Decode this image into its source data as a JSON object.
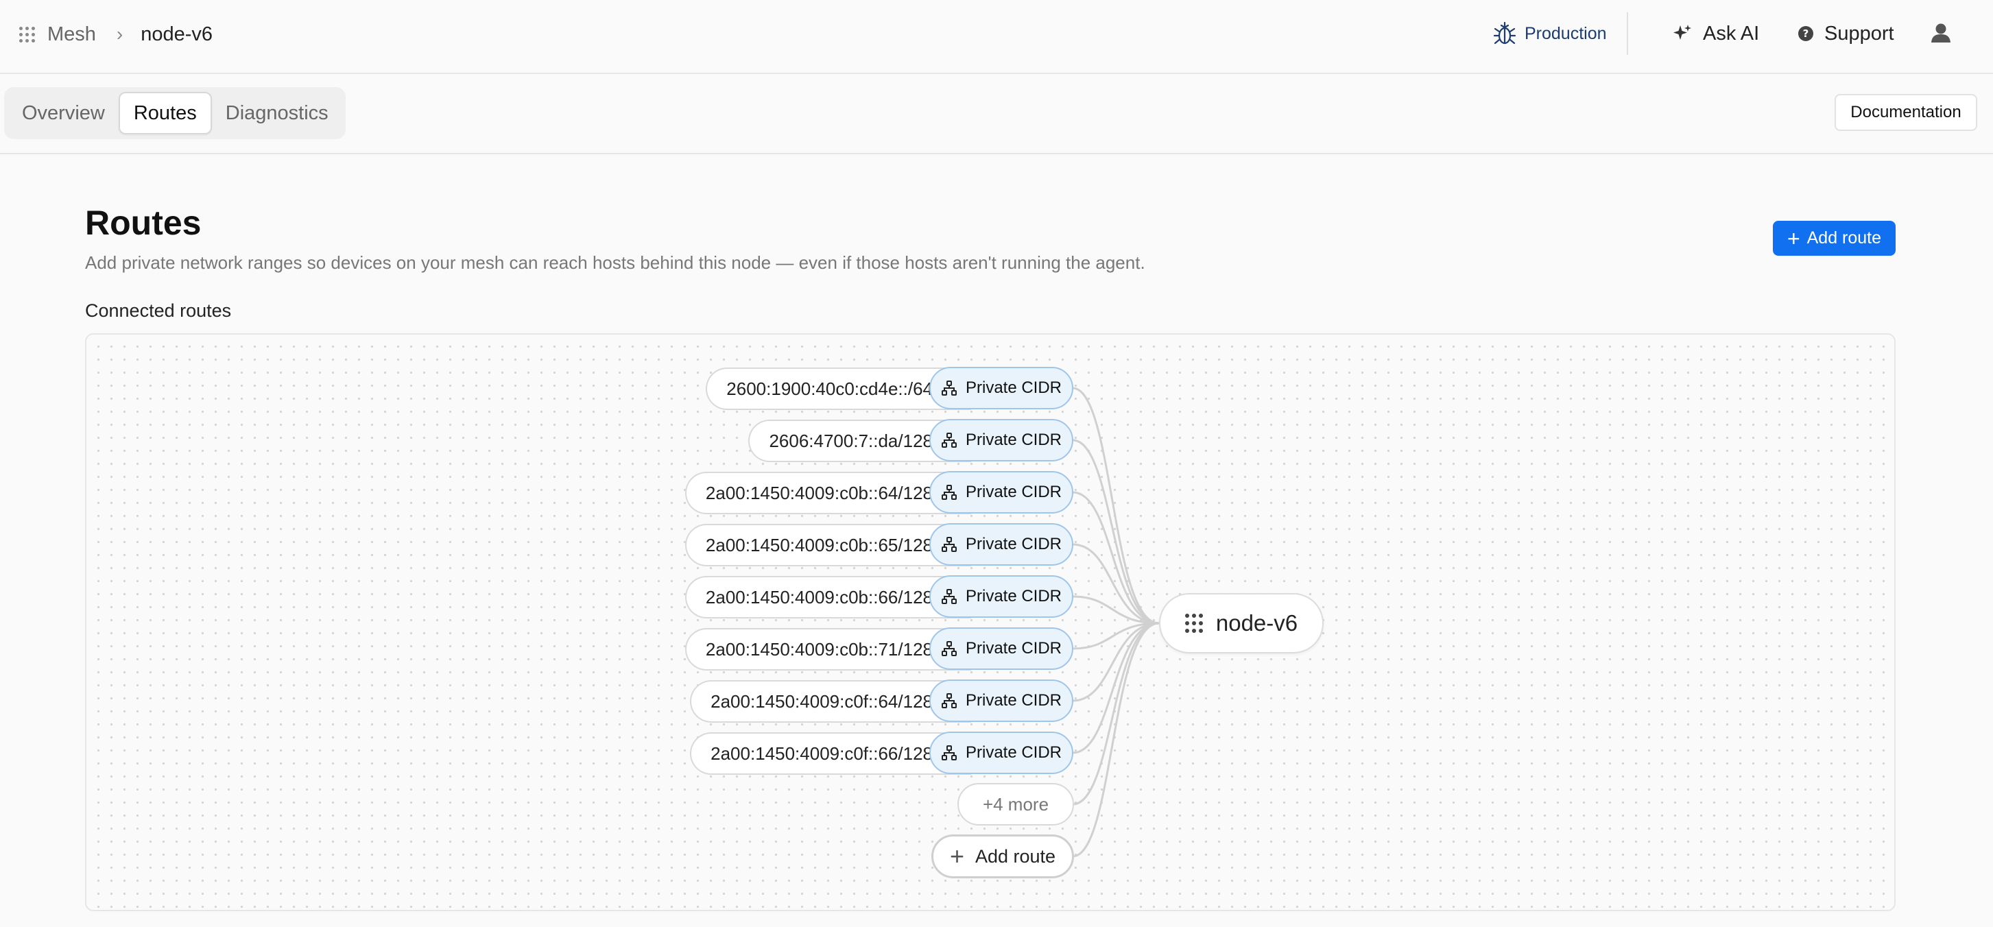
{
  "breadcrumb": {
    "root": "Mesh",
    "current": "node-v6"
  },
  "header": {
    "environment": "Production",
    "ask_ai": "Ask AI",
    "support": "Support"
  },
  "tabs": [
    {
      "label": "Overview",
      "active": false
    },
    {
      "label": "Routes",
      "active": true
    },
    {
      "label": "Diagnostics",
      "active": false
    }
  ],
  "documentation_label": "Documentation",
  "page": {
    "title": "Routes",
    "description": "Add private network ranges so devices on your mesh can reach hosts behind this node — even if those hosts aren't running the agent.",
    "add_route_label": "Add route",
    "section_label": "Connected routes"
  },
  "routes": [
    {
      "cidr": "2600:1900:40c0:cd4e::/64",
      "type": "Private CIDR"
    },
    {
      "cidr": "2606:4700:7::da/128",
      "type": "Private CIDR"
    },
    {
      "cidr": "2a00:1450:4009:c0b::64/128",
      "type": "Private CIDR"
    },
    {
      "cidr": "2a00:1450:4009:c0b::65/128",
      "type": "Private CIDR"
    },
    {
      "cidr": "2a00:1450:4009:c0b::66/128",
      "type": "Private CIDR"
    },
    {
      "cidr": "2a00:1450:4009:c0b::71/128",
      "type": "Private CIDR"
    },
    {
      "cidr": "2a00:1450:4009:c0f::64/128",
      "type": "Private CIDR"
    },
    {
      "cidr": "2a00:1450:4009:c0f::66/128",
      "type": "Private CIDR"
    }
  ],
  "more_label": "+4 more",
  "graph_add_route_label": "Add route",
  "node_label": "node-v6",
  "colors": {
    "accent": "#1170f0",
    "cidr_bg": "#e9f3fc",
    "cidr_border": "#9fc6ea",
    "link": "#d0d0d0"
  }
}
